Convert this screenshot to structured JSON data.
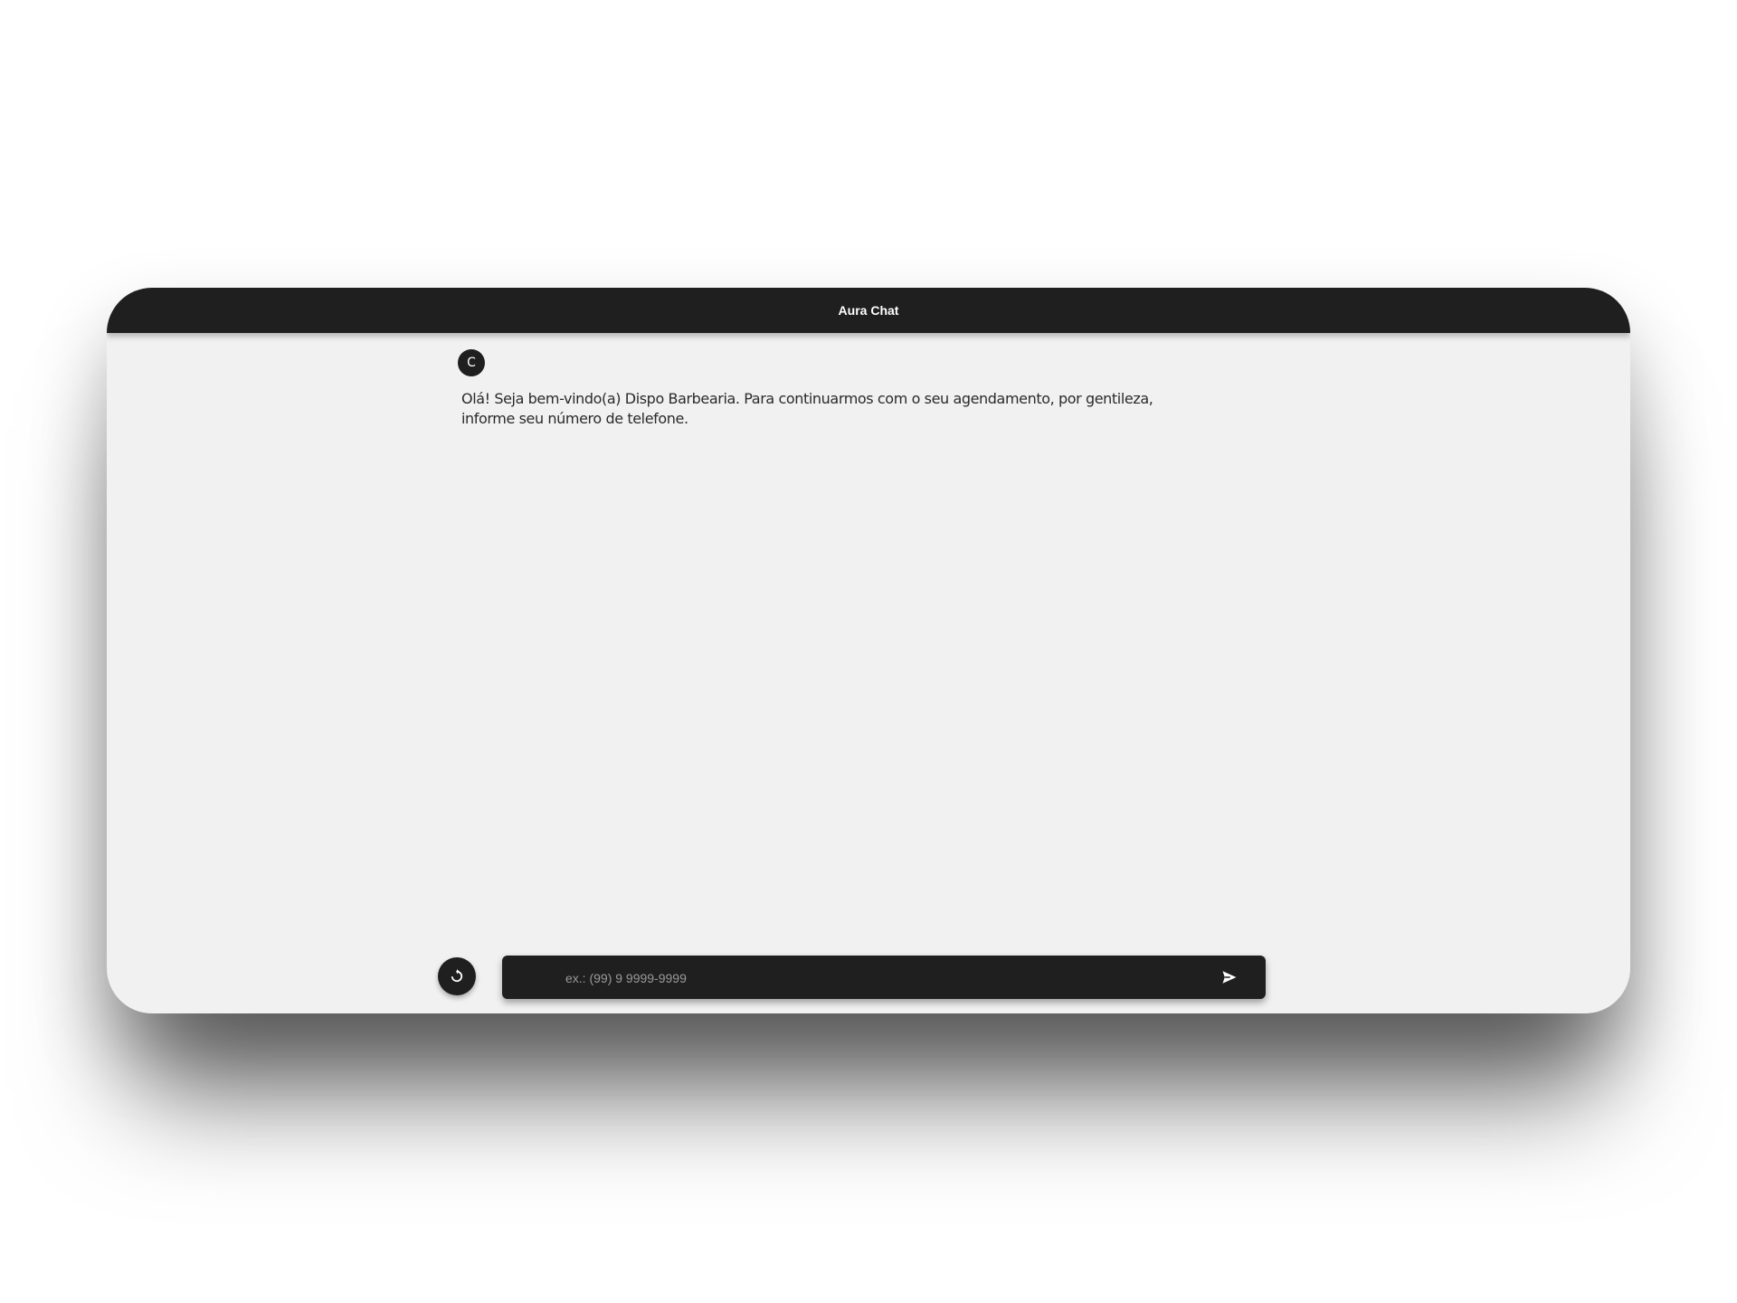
{
  "header": {
    "title": "Aura Chat"
  },
  "messages": [
    {
      "sender": "bot",
      "avatar_letter": "C",
      "text": "Olá! Seja bem-vindo(a) Dispo Barbearia. Para continuarmos com o seu agendamento, por gentileza, informe seu número de telefone."
    }
  ],
  "composer": {
    "placeholder": "ex.: (99) 9 9999-9999",
    "value": "",
    "reset_icon": "refresh-icon",
    "send_icon": "send-icon"
  },
  "colors": {
    "header_bg": "#1f1f1f",
    "chat_bg": "#f1f1f1",
    "input_bg": "#1f1f1f",
    "text": "#2a2a2a"
  }
}
